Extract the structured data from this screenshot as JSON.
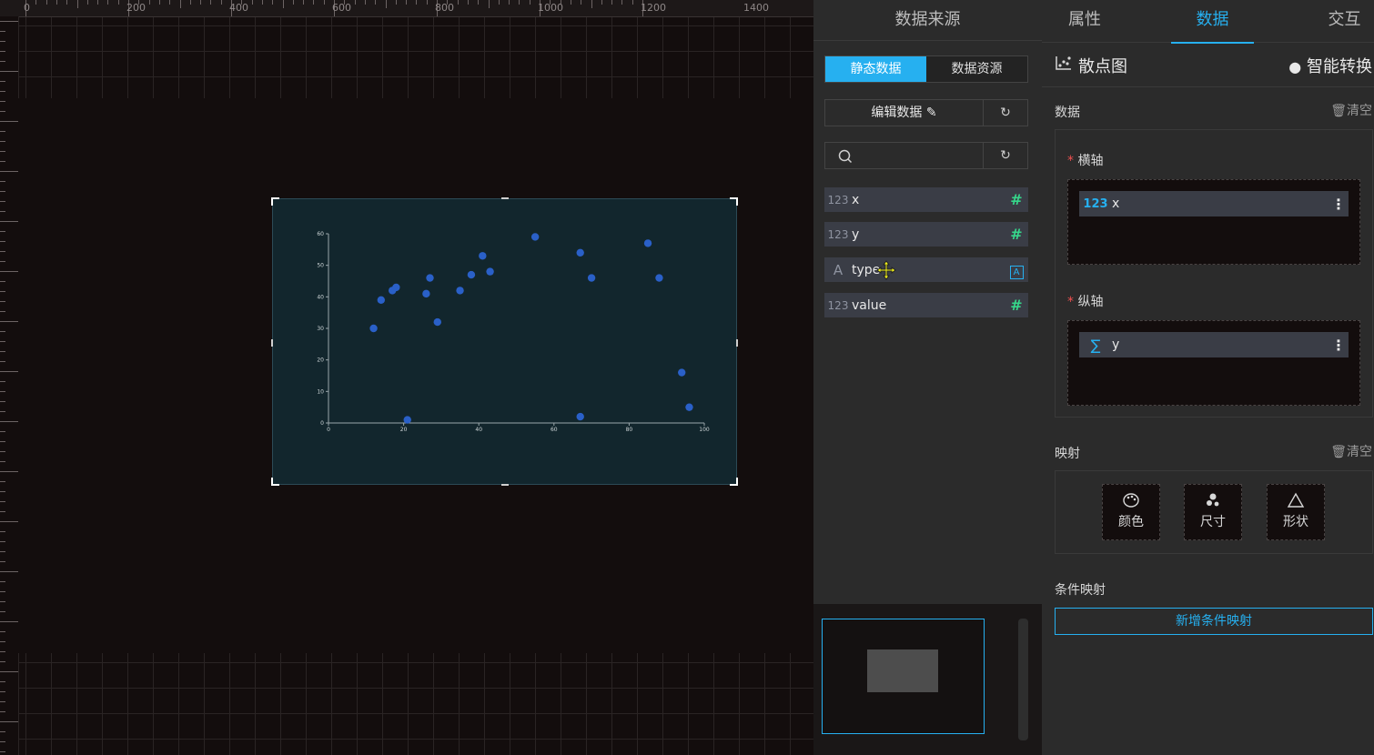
{
  "ruler": {
    "labels": [
      "0",
      "200",
      "400",
      "600",
      "800",
      "1000",
      "1200",
      "1400"
    ]
  },
  "source_panel": {
    "title": "数据来源",
    "seg_static": "静态数据",
    "seg_resource": "数据资源",
    "edit_label": "编辑数据",
    "fields": [
      {
        "type_label": "123",
        "name": "x",
        "kind": "number"
      },
      {
        "type_label": "123",
        "name": "y",
        "kind": "number"
      },
      {
        "type_label": "A",
        "name": "type",
        "kind": "text"
      },
      {
        "type_label": "123",
        "name": "value",
        "kind": "number"
      }
    ]
  },
  "prop_panel": {
    "tabs": [
      "属性",
      "数据",
      "交互"
    ],
    "active_tab": "数据",
    "chart_type": "散点图",
    "smart_convert": "智能转换",
    "data_title": "数据",
    "clear_label": "清空",
    "x_axis_label": "横轴",
    "y_axis_label": "纵轴",
    "required_mark": "*",
    "x_chip": {
      "type_label": "123",
      "name": "x"
    },
    "y_chip": {
      "type_label": "∑",
      "name": "y"
    },
    "mapping_title": "映射",
    "map_color": "颜色",
    "map_size": "尺寸",
    "map_shape": "形状",
    "cond_title": "条件映射",
    "add_cond": "新增条件映射"
  },
  "colors": {
    "accent": "#26b0f0",
    "point": "#2a60c8",
    "chart_bg": "#12262d",
    "green": "#36d68a"
  },
  "chart_data": {
    "type": "scatter",
    "xlim": [
      0,
      100
    ],
    "ylim": [
      0,
      60
    ],
    "xticks": [
      0,
      20,
      40,
      60,
      80,
      100
    ],
    "yticks": [
      0,
      10,
      20,
      30,
      40,
      50,
      60
    ],
    "points": [
      {
        "x": 12,
        "y": 30
      },
      {
        "x": 14,
        "y": 39
      },
      {
        "x": 17,
        "y": 42
      },
      {
        "x": 18,
        "y": 43
      },
      {
        "x": 21,
        "y": 1
      },
      {
        "x": 26,
        "y": 41
      },
      {
        "x": 27,
        "y": 46
      },
      {
        "x": 29,
        "y": 32
      },
      {
        "x": 35,
        "y": 42
      },
      {
        "x": 38,
        "y": 47
      },
      {
        "x": 41,
        "y": 53
      },
      {
        "x": 43,
        "y": 48
      },
      {
        "x": 55,
        "y": 59
      },
      {
        "x": 67,
        "y": 54
      },
      {
        "x": 67,
        "y": 2
      },
      {
        "x": 70,
        "y": 46
      },
      {
        "x": 85,
        "y": 57
      },
      {
        "x": 88,
        "y": 46
      },
      {
        "x": 94,
        "y": 16
      },
      {
        "x": 96,
        "y": 5
      }
    ]
  }
}
